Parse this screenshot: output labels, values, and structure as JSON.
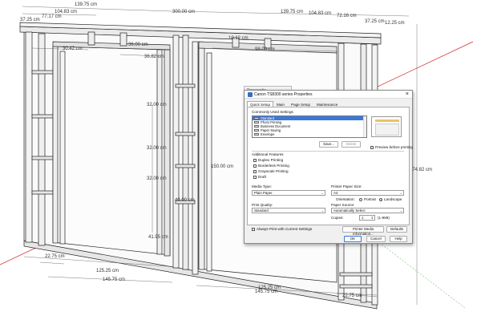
{
  "dimensions": {
    "top_row": [
      "139.75 cm",
      "300.00 cm",
      "139.75 cm",
      "104.83 cm",
      "72.16 cm",
      "104.83 cm",
      "77.17 cm",
      "37.25 cm",
      "12.25 cm",
      "37.25 cm"
    ],
    "left_upper": [
      "30.42 cm",
      "36.00 cm",
      "36.82 cm"
    ],
    "right_upper": [
      "10.12 cm",
      "98.00 cm"
    ],
    "heights": [
      "32.00 cm",
      "32.00 cm",
      "32.00 cm",
      "41.95 cm",
      "150.00 cm",
      "40.00 cm"
    ],
    "overall_height": "274.82 cm",
    "bottom": [
      "22.75 cm",
      "125.25 cm",
      "145.75 cm",
      "145.75 cm",
      "125.25 cm",
      "22.75 cm"
    ]
  },
  "dialog": {
    "ghost_title": "Ppresentio",
    "title": "Canon TS8300 series Properties",
    "tabs": [
      "Quick Setup",
      "Main",
      "Page Setup",
      "Maintenance"
    ],
    "common_settings_label": "Commonly Used Settings",
    "settings_items": [
      "Standard",
      "Photo Printing",
      "Business Document",
      "Paper Saving",
      "Envelope"
    ],
    "save_label": "Save...",
    "delete_label": "Delete",
    "preview_label": "Preview before printing",
    "additional_features_label": "Additional Features",
    "features": [
      "Duplex Printing",
      "Borderless Printing",
      "Grayscale Printing",
      "Draft"
    ],
    "media_type_label": "Media Type:",
    "media_type_value": "Plain Paper",
    "paper_size_label": "Printer Paper Size:",
    "paper_size_value": "A4",
    "orientation_label": "Orientation:",
    "portrait_label": "Portrait",
    "landscape_label": "Landscape",
    "print_quality_label": "Print Quality:",
    "print_quality_value": "Standard",
    "paper_source_label": "Paper Source:",
    "paper_source_value": "Automatically Select",
    "copies_label": "Copies:",
    "copies_value": "1",
    "copies_range": "(1-999)",
    "always_print_label": "Always Print with Current Settings",
    "printer_media_info_label": "Printer Media Information...",
    "defaults_label": "Defaults",
    "ok_label": "OK",
    "cancel_label": "Cancel",
    "help_label": "Help",
    "close_glyph": "×",
    "dropdown_glyph": "⌄",
    "spin_glyph": "⇕"
  },
  "colors": {
    "selection": "#3b78d8",
    "axis_red": "#d12b2b"
  }
}
